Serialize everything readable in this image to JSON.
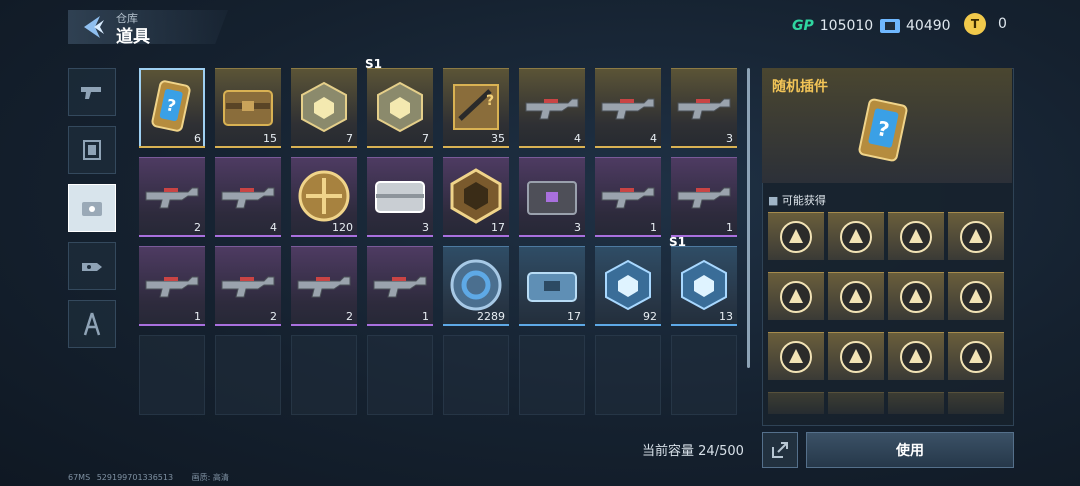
{
  "header": {
    "breadcrumb": "仓库",
    "title": "道具"
  },
  "currencies": [
    {
      "icon": "gp-currency-icon",
      "label": "GP",
      "value": "105010"
    },
    {
      "icon": "ticket-currency-icon",
      "label": "",
      "value": "40490"
    },
    {
      "icon": "gold-currency-icon",
      "label": "T",
      "value": "0"
    }
  ],
  "side_tabs": [
    {
      "name": "weapons",
      "icon": "pistol-icon",
      "active": false
    },
    {
      "name": "gear",
      "icon": "module-icon",
      "active": false
    },
    {
      "name": "items",
      "icon": "items-icon",
      "active": true
    },
    {
      "name": "equipment",
      "icon": "gadget-icon",
      "active": false
    },
    {
      "name": "appearance",
      "icon": "figure-icon",
      "active": false
    }
  ],
  "grid": {
    "items": [
      {
        "kind": "card",
        "rarity": "gold",
        "count": "6",
        "selected": true,
        "season": ""
      },
      {
        "kind": "crate",
        "rarity": "gold",
        "count": "15",
        "season": ""
      },
      {
        "kind": "cube",
        "rarity": "gold",
        "count": "7",
        "season": ""
      },
      {
        "kind": "cube",
        "rarity": "gold",
        "count": "7",
        "season": "S1"
      },
      {
        "kind": "mystery-weapon",
        "rarity": "gold",
        "count": "35",
        "season": ""
      },
      {
        "kind": "rifle",
        "rarity": "gold",
        "count": "4",
        "season": ""
      },
      {
        "kind": "rifle",
        "rarity": "gold",
        "count": "4",
        "season": ""
      },
      {
        "kind": "rifle",
        "rarity": "gold",
        "count": "3",
        "season": ""
      },
      {
        "kind": "rifle",
        "rarity": "purple",
        "count": "2",
        "season": ""
      },
      {
        "kind": "rifle",
        "rarity": "purple",
        "count": "4",
        "season": ""
      },
      {
        "kind": "coin",
        "rarity": "purple",
        "count": "120",
        "season": ""
      },
      {
        "kind": "case",
        "rarity": "purple",
        "count": "3",
        "season": ""
      },
      {
        "kind": "hex-badge",
        "rarity": "purple",
        "count": "17",
        "season": ""
      },
      {
        "kind": "crate-dark",
        "rarity": "purple",
        "count": "3",
        "season": ""
      },
      {
        "kind": "rifle",
        "rarity": "purple",
        "count": "1",
        "season": ""
      },
      {
        "kind": "rifle",
        "rarity": "purple",
        "count": "1",
        "season": ""
      },
      {
        "kind": "rifle",
        "rarity": "purple",
        "count": "1",
        "season": ""
      },
      {
        "kind": "rifle",
        "rarity": "purple",
        "count": "2",
        "season": ""
      },
      {
        "kind": "rifle",
        "rarity": "purple",
        "count": "2",
        "season": ""
      },
      {
        "kind": "rifle",
        "rarity": "purple",
        "count": "1",
        "season": ""
      },
      {
        "kind": "ring-coin",
        "rarity": "blue",
        "count": "2289",
        "season": ""
      },
      {
        "kind": "case-blue",
        "rarity": "blue",
        "count": "17",
        "season": ""
      },
      {
        "kind": "cube-blue",
        "rarity": "blue",
        "count": "92",
        "season": ""
      },
      {
        "kind": "cube-blue",
        "rarity": "blue",
        "count": "13",
        "season": "S1"
      }
    ],
    "empty_slots": 8
  },
  "capacity": {
    "label": "当前容量",
    "value": "24/500"
  },
  "detail": {
    "title": "随机插件",
    "possible_label": "可能获得",
    "rewards": [
      "plugin-wings-icon",
      "plugin-target-icon",
      "plugin-claw-icon",
      "plugin-lock-icon",
      "plugin-up-icon",
      "plugin-crosshair-icon",
      "plugin-bullets-icon",
      "plugin-gun-icon",
      "plugin-battery-icon",
      "plugin-spread-icon",
      "plugin-ammo-icon",
      "plugin-shield-icon"
    ]
  },
  "actions": {
    "use_label": "使用"
  },
  "status_bar": {
    "ping": "67MS",
    "id": "529199701336513",
    "quality_label": "画质:",
    "quality_value": "高清"
  },
  "colors": {
    "gold": "#d9b253",
    "purple": "#a970de",
    "blue": "#5ea9e6",
    "accent": "#f2c457"
  }
}
